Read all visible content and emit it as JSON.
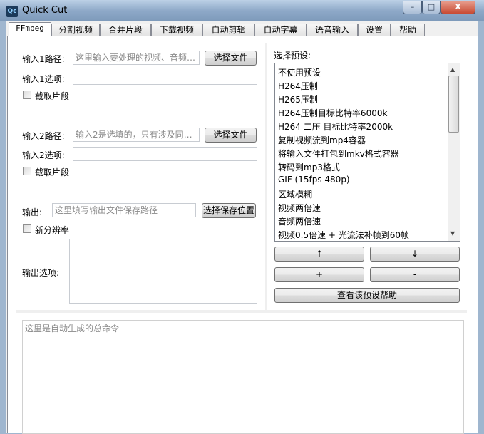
{
  "window": {
    "title": "Quick Cut",
    "icon_text": "Qc",
    "minimize": "–",
    "maximize": "□",
    "close": "X"
  },
  "tabs": [
    "FFmpeg",
    "分割视频",
    "合并片段",
    "下载视频",
    "自动剪辑",
    "自动字幕",
    "语音输入",
    "设置",
    "帮助"
  ],
  "input1": {
    "path_label": "输入1路径:",
    "path_placeholder": "这里输入要处理的视频、音频…",
    "choose_label": "选择文件",
    "options_label": "输入1选项:",
    "options_value": "",
    "clip_label": "截取片段"
  },
  "input2": {
    "path_label": "输入2路径:",
    "path_placeholder": "输入2是选填的，只有涉及同…",
    "choose_label": "选择文件",
    "options_label": "输入2选项:",
    "options_value": "",
    "clip_label": "截取片段"
  },
  "output": {
    "label": "输出:",
    "placeholder": "这里填写输出文件保存路径",
    "choose_label": "选择保存位置",
    "resolution_label": "新分辨率",
    "options_label": "输出选项:",
    "options_value": ""
  },
  "presets": {
    "label": "选择预设:",
    "items": [
      "不使用预设",
      "H264压制",
      "H265压制",
      "H264压制目标比特率6000k",
      "H264 二压 目标比特率2000k",
      "复制视频流到mp4容器",
      "将输入文件打包到mkv格式容器",
      "转码到mp3格式",
      "GIF (15fps 480p)",
      "区域模糊",
      "视频两倍速",
      "音频两倍速",
      "视频0.5倍速 + 光流法补帧到60帧"
    ],
    "up": "↑",
    "down": "↓",
    "add": "+",
    "remove": "-",
    "help": "查看该预设帮助"
  },
  "command": {
    "placeholder": "这里是自动生成的总命令"
  }
}
